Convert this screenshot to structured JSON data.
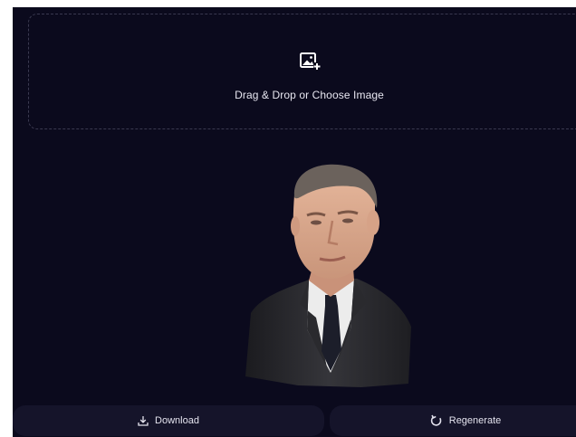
{
  "dropzone": {
    "icon": "add-image-icon",
    "text": "Drag & Drop or Choose Image"
  },
  "preview": {
    "description_icon": "avatar-bust-preview"
  },
  "actions": {
    "download_label": "Download",
    "download_icon": "download-icon",
    "regenerate_label": "Regenerate",
    "regenerate_icon": "refresh-icon"
  },
  "colors": {
    "background": "#0b0a1d",
    "button": "#15142a",
    "text": "#e7e6f0",
    "dropzone_border": "#3a3950"
  }
}
